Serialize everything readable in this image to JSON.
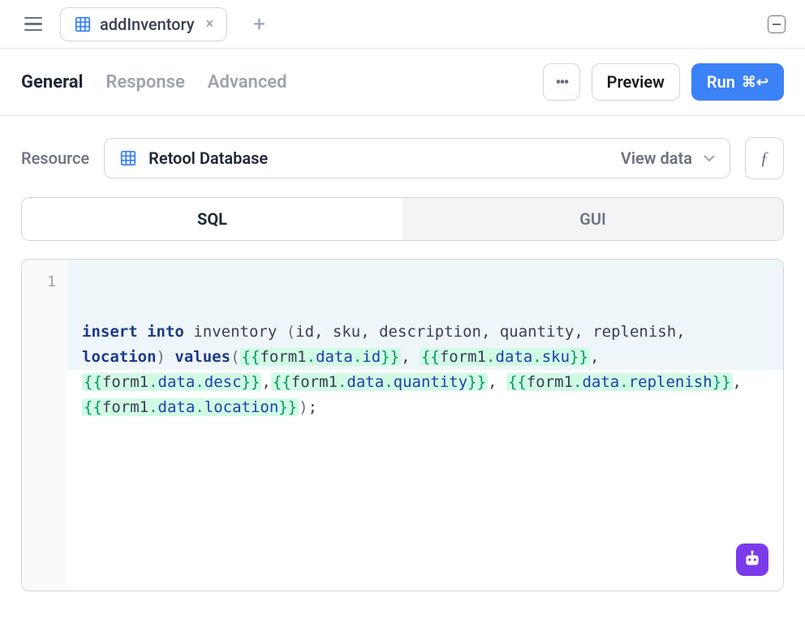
{
  "topbar": {
    "tab_name": "addInventory",
    "close_label": "×",
    "new_tab_label": "+"
  },
  "subnav": {
    "tabs": [
      {
        "label": "General",
        "active": true
      },
      {
        "label": "Response",
        "active": false
      },
      {
        "label": "Advanced",
        "active": false
      }
    ],
    "more_label": "•••",
    "preview_label": "Preview",
    "run_label": "Run",
    "run_shortcut": "⌘↩"
  },
  "resource": {
    "label": "Resource",
    "name": "Retool Database",
    "view_data_label": "View data",
    "fx_label": "ƒ"
  },
  "mode": {
    "sql": "SQL",
    "gui": "GUI"
  },
  "editor": {
    "line_number": "1",
    "keywords": {
      "insert": "insert",
      "into": "into",
      "values": "values",
      "location_kw": "location"
    },
    "table": "inventory",
    "columns": "id, sku, description, quantity, replenish, ",
    "templates": {
      "id": {
        "obj": "form1",
        "p1": "data",
        "p2": "id"
      },
      "sku": {
        "obj": "form1",
        "p1": "data",
        "p2": "sku"
      },
      "desc": {
        "obj": "form1",
        "p1": "data",
        "p2": "desc"
      },
      "quantity": {
        "obj": "form1",
        "p1": "data",
        "p2": "quantity"
      },
      "replenish": {
        "obj": "form1",
        "p1": "data",
        "p2": "replenish"
      },
      "location": {
        "obj": "form1",
        "p1": "data",
        "p2": "location"
      }
    }
  },
  "colors": {
    "primary": "#3b82f6",
    "chatbot": "#7c3aed",
    "keyword": "#1e3a8a",
    "template_bg": "#d1fae5",
    "template_bracket": "#059669"
  }
}
